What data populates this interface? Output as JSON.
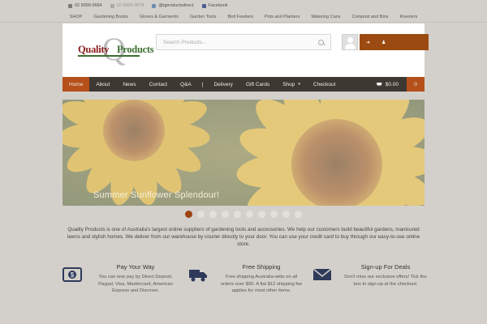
{
  "topbar": {
    "phone1": "02 9999 0684",
    "phone2": "02 9999 0878",
    "twitter": "@qproductsdirect",
    "facebook": "Facebook"
  },
  "catnav": [
    "SHOP",
    "Gardening Books",
    "Gloves & Garments",
    "Garden Tools",
    "Bird Feeders",
    "Pots and Planters",
    "Watering Cans",
    "Compost and Bins",
    "Kneelers"
  ],
  "logo": {
    "word1": "Quality",
    "word2": "Products",
    "mark": "Q"
  },
  "search": {
    "placeholder": "Search Products..."
  },
  "account": {
    "icon1": "login-icon",
    "icon2": "register-icon",
    "glyph1": "➜",
    "glyph2": "♟"
  },
  "mainnav": {
    "items": [
      "Home",
      "About",
      "News",
      "Contact",
      "Q&A",
      "|",
      "Delivery",
      "Gift Cards",
      "Shop",
      "Checkout"
    ],
    "shop_caret": "▾",
    "cart_total": "$0.00",
    "cart_count": "0"
  },
  "slider": {
    "caption": "Summer Sunflower Splendour!",
    "dot_count": 10,
    "active_dot": 0
  },
  "intro": "Quality Products is one of Australia's largest online suppliers of gardening tools and accessories. We help our customers build beautiful gardens, manicured lawns and stylish homes. We deliver from our warehouse by courier directly to your door. You can use your credit card to buy through our easy-to-use online store.",
  "features": [
    {
      "icon": "dollar-icon",
      "title": "Pay Your Way",
      "text": "You can now pay by Direct Deposit, Paypal, Visa, Mastercard, American Express and Discover."
    },
    {
      "icon": "truck-icon",
      "title": "Free Shipping",
      "text": "Free shipping Australia-wide on all orders over $90. A flat $12 shipping fee applies for most other items."
    },
    {
      "icon": "envelope-icon",
      "title": "Sign-up For Deals",
      "text": "Don't miss our exclusive offers! Tick the box to sign-up at the checkout."
    }
  ],
  "colors": {
    "accent": "#b5501a",
    "nav_bg": "#3e3833",
    "page_bg": "#d3d0cb",
    "logo_red": "#8a1e1e",
    "logo_green": "#3c6e2e"
  }
}
